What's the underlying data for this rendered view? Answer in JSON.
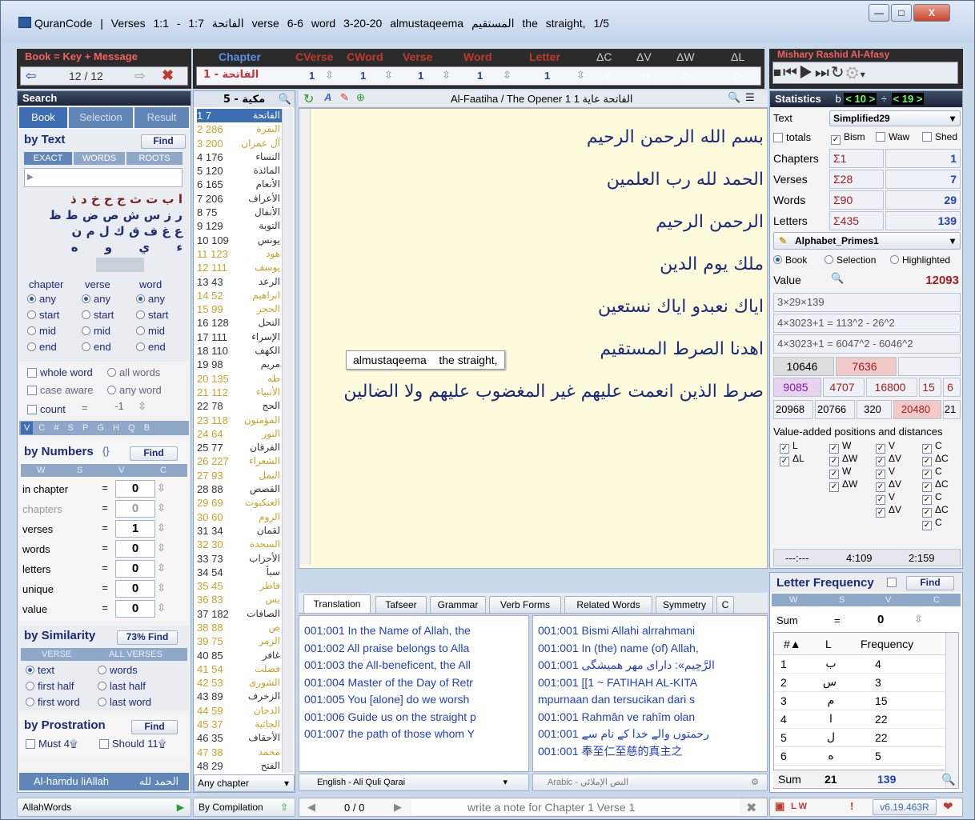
{
  "window": {
    "icon": "book-icon",
    "title": "QuranCode | Verses 1:1 - 1:7   الفاتحة   verse 6-6   word 3-20-20   almustaqeema   المستقيم   the straight,   1/5",
    "min": "—",
    "max": "□",
    "close": "X"
  },
  "book_key": {
    "header": "Book = Key + Message",
    "position": "12 / 12"
  },
  "nav_headers": {
    "chapter": "Chapter",
    "cverse": "CVerse",
    "cword": "CWord",
    "verse": "Verse",
    "word": "Word",
    "letter": "Letter",
    "dc": "ΔC",
    "dv": "ΔV",
    "dw": "ΔW",
    "dl": "ΔL"
  },
  "nav_values": {
    "chapter": "الفاتحة - 1",
    "cverse": "1",
    "cword": "1",
    "verse": "1",
    "word": "1",
    "letter": "1",
    "pm": "-/+"
  },
  "reciter": {
    "name": "Mishary Rashid Al-Afasy"
  },
  "search": {
    "header": "Search",
    "tabs": [
      "Book",
      "Selection",
      "Result"
    ],
    "by_text": "by Text",
    "find": "Find",
    "modes": [
      "EXACT",
      "WORDS",
      "ROOTS"
    ],
    "letter_rows": [
      "ا ب ت ث ج ح خ د ذ",
      "ر ز س ش ص ض ط ظ",
      "ع غ ف ق ك ل م ن",
      "ء ي و ه"
    ],
    "col_heads": [
      "chapter",
      "verse",
      "word"
    ],
    "opts": [
      "any",
      "start",
      "mid",
      "end"
    ],
    "whole_word": "whole word",
    "all_words": "all words",
    "case_aware": "case aware",
    "any_word": "any word",
    "count": "count",
    "count_op": "=",
    "count_val": "-1",
    "filter_tabs": [
      "V",
      "C",
      "#",
      "S",
      "P",
      "G",
      "H",
      "Q",
      "B"
    ]
  },
  "by_numbers": {
    "title": "by Numbers",
    "sym": "{}",
    "find": "Find",
    "cols": [
      "W",
      "S",
      "V",
      "C"
    ],
    "rows": [
      {
        "label": "in chapter",
        "op": "=",
        "val": "0"
      },
      {
        "label": "chapters",
        "op": "=",
        "val": "0"
      },
      {
        "label": "verses",
        "op": "=",
        "val": "1"
      },
      {
        "label": "words",
        "op": "=",
        "val": "0"
      },
      {
        "label": "letters",
        "op": "=",
        "val": "0"
      },
      {
        "label": "unique",
        "op": "=",
        "val": "0"
      },
      {
        "label": "value",
        "op": "=",
        "val": "0"
      }
    ]
  },
  "by_similarity": {
    "title": "by Similarity",
    "find": "73% Find",
    "cols": [
      "VERSE",
      "ALL VERSES"
    ],
    "opts": [
      [
        "text",
        "words"
      ],
      [
        "first half",
        "last half"
      ],
      [
        "first word",
        "last word"
      ]
    ]
  },
  "by_prostration": {
    "title": "by Prostration",
    "find": "Find",
    "must": "Must 4۩",
    "should": "Should 11۩"
  },
  "footer_left": {
    "latin": "Al-hamdu liAllah",
    "arabic": "الحمد لله",
    "allahwords": "AllahWords"
  },
  "chapters_list": {
    "header": "مكية - 5",
    "items": [
      [
        "1",
        "7",
        "الفاتحة"
      ],
      [
        "2",
        "286",
        "البقرة"
      ],
      [
        "3",
        "200",
        "آل عمران"
      ],
      [
        "4",
        "176",
        "النساء"
      ],
      [
        "5",
        "120",
        "المائدة"
      ],
      [
        "6",
        "165",
        "الأنعام"
      ],
      [
        "7",
        "206",
        "الأعراف"
      ],
      [
        "8",
        "75",
        "الأنفال"
      ],
      [
        "9",
        "129",
        "التوبة"
      ],
      [
        "10",
        "109",
        "يونس"
      ],
      [
        "11",
        "123",
        "هود"
      ],
      [
        "12",
        "111",
        "يوسف"
      ],
      [
        "13",
        "43",
        "الرعد"
      ],
      [
        "14",
        "52",
        "ابراهيم"
      ],
      [
        "15",
        "99",
        "الحجر"
      ],
      [
        "16",
        "128",
        "النحل"
      ],
      [
        "17",
        "111",
        "الإسراء"
      ],
      [
        "18",
        "110",
        "الكهف"
      ],
      [
        "19",
        "98",
        "مريم"
      ],
      [
        "20",
        "135",
        "طه"
      ],
      [
        "21",
        "112",
        "الأنبياء"
      ],
      [
        "22",
        "78",
        "الحج"
      ],
      [
        "23",
        "118",
        "المؤمنون"
      ],
      [
        "24",
        "64",
        "النور"
      ],
      [
        "25",
        "77",
        "الفرقان"
      ],
      [
        "26",
        "227",
        "الشعراء"
      ],
      [
        "27",
        "93",
        "النمل"
      ],
      [
        "28",
        "88",
        "القصص"
      ],
      [
        "29",
        "69",
        "العنكبوت"
      ],
      [
        "30",
        "60",
        "الروم"
      ],
      [
        "31",
        "34",
        "لقمان"
      ],
      [
        "32",
        "30",
        "السجدة"
      ],
      [
        "33",
        "73",
        "الأحزاب"
      ],
      [
        "34",
        "54",
        "سبأ"
      ],
      [
        "35",
        "45",
        "فاطر"
      ],
      [
        "36",
        "83",
        "يس"
      ],
      [
        "37",
        "182",
        "الصافات"
      ],
      [
        "38",
        "88",
        "ص"
      ],
      [
        "39",
        "75",
        "الزمر"
      ],
      [
        "40",
        "85",
        "غافر"
      ],
      [
        "41",
        "54",
        "فصلت"
      ],
      [
        "42",
        "53",
        "الشورى"
      ],
      [
        "43",
        "89",
        "الزخرف"
      ],
      [
        "44",
        "59",
        "الدخان"
      ],
      [
        "45",
        "37",
        "الجاثية"
      ],
      [
        "46",
        "35",
        "الأحقاف"
      ],
      [
        "47",
        "38",
        "محمد"
      ],
      [
        "48",
        "29",
        "الفتح"
      ]
    ],
    "any_chapter": "Any chapter",
    "by_compilation": "By Compilation"
  },
  "reader": {
    "heading": "Al-Faatiha / The Opener 1  الفاتحة  عاية 1",
    "verses": [
      "بسم الله الرحمن الرحيم",
      "الحمد لله رب العلمين",
      "الرحمن الرحيم",
      "ملك يوم الدين",
      "اياك نعبدو اياك نستعين",
      "اهدنا الصرط المستقيم",
      "صرط الذين انعمت عليهم غير المغضوب عليهم ولا الضالين"
    ],
    "tooltip": "almustaqeema    the straight,"
  },
  "bottom_tabs": [
    "Translation",
    "Tafseer",
    "Grammar",
    "Verb Forms",
    "Related Words",
    "Symmetry",
    "C"
  ],
  "translation": [
    "001:001 In the Name of Allah, the",
    "001:002 All praise belongs to Alla",
    "001:003 the All-beneficent, the All",
    "001:004 Master of the Day of Retr",
    "001:005 You [alone] do we worsh",
    "001:006 Guide us on the straight p",
    "001:007 the path of those whom Y"
  ],
  "translation2": [
    "001:001 Bismi Allahi alrrahmani",
    "001:001 In (the) name (of) Allah,",
    "001:001 الرَّحِيم»: داراى مهر همیشگی",
    "001:001 [[1 ~ FATIHAH AL-KITA",
    "mpurnaan dan tersucikan dari s",
    "001:001 Rahmân ve rahîm olan",
    "001:001 رحمتوں والے خدا کے نام سے",
    "001:001 奉至仁至慈的真主之"
  ],
  "translation_lang": "English - Ali Quli Qarai",
  "arabic_lang": "Arabic - النص الإملائي",
  "note": {
    "counter": "0 / 0",
    "placeholder": "write a note for Chapter 1 Verse 1"
  },
  "stats": {
    "header": "Statistics",
    "b_label": "b",
    "b_val": "< 10 >",
    "div": "÷",
    "d_val": "< 19 >",
    "text_label": "Text",
    "text_mode": "Simplified29",
    "totals": "totals",
    "bism": "Bism",
    "waw": "Waw",
    "shed": "Shed",
    "rows": [
      {
        "label": "Chapters",
        "sigma": "Σ1",
        "val": "1"
      },
      {
        "label": "Verses",
        "sigma": "Σ28",
        "val": "7"
      },
      {
        "label": "Words",
        "sigma": "Σ90",
        "val": "29"
      },
      {
        "label": "Letters",
        "sigma": "Σ435",
        "val": "139"
      }
    ],
    "system": "Alphabet_Primes1",
    "scope": [
      "Book",
      "Selection",
      "Highlighted"
    ],
    "value_label": "Value",
    "value": "12093",
    "lines": [
      "3×29×139",
      "4×3023+1 = 113^2 - 26^2",
      "4×3023+1 = 6047^2 - 6046^2"
    ],
    "nums1": [
      "10646",
      "7636",
      ""
    ],
    "nums2": [
      "9085",
      "4707",
      "16800",
      "15",
      "6"
    ],
    "nums3": [
      "20968",
      "20766",
      "320",
      "20480",
      "21"
    ],
    "vap": "Value-added positions and distances",
    "ll": [
      "L",
      "ΔL"
    ],
    "wcol": [
      "W",
      "ΔW",
      "W",
      "ΔW"
    ],
    "vcol": [
      "V",
      "ΔV",
      "V",
      "ΔV",
      "V",
      "ΔV"
    ],
    "ccol": [
      "C",
      "ΔC",
      "C",
      "ΔC",
      "C",
      "ΔC",
      "C"
    ],
    "bottom": [
      "---:---",
      "4:109",
      "2:159"
    ]
  },
  "letter_freq": {
    "title": "Letter Frequency",
    "find": "Find",
    "cols": [
      "W",
      "S",
      "V",
      "C"
    ],
    "sum_label": "Sum",
    "sum_op": "=",
    "sum_val": "0",
    "th": [
      "#▲",
      "L",
      "Frequency"
    ],
    "rows": [
      [
        "1",
        "ب",
        "4"
      ],
      [
        "2",
        "س",
        "3"
      ],
      [
        "3",
        "م",
        "15"
      ],
      [
        "4",
        "ا",
        "22"
      ],
      [
        "5",
        "ل",
        "22"
      ],
      [
        "6",
        "ه",
        "5"
      ]
    ],
    "total_label": "Sum",
    "total_count": "21",
    "total_freq": "139"
  },
  "status": {
    "version": "v6.19.463R",
    "icons": "L W"
  }
}
